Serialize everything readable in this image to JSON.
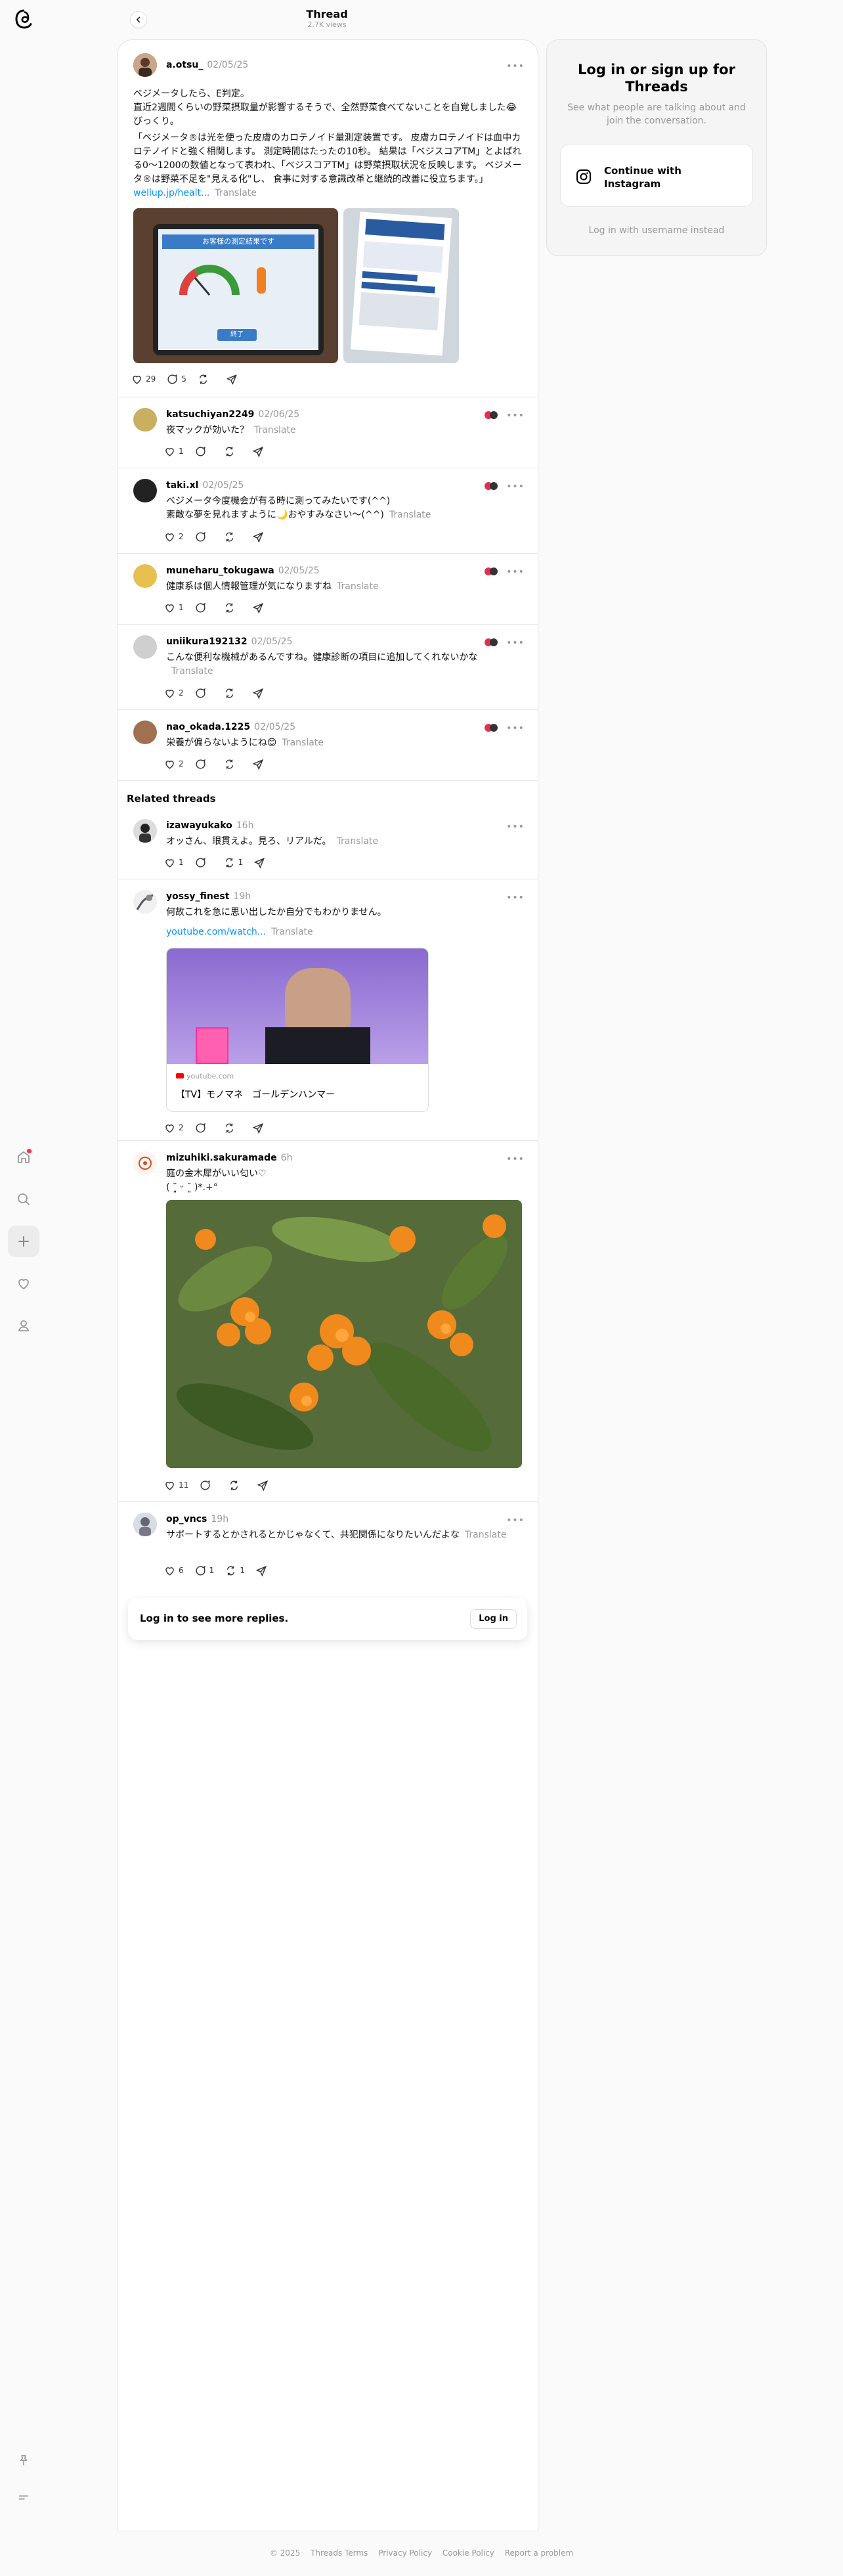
{
  "header": {
    "title": "Thread",
    "views": "2.7K views"
  },
  "main_post": {
    "username": "a.otsu_",
    "date": "02/05/25",
    "line1": "ベジメータしたら、E判定。",
    "line2": "直近2週間くらいの野菜摂取量が影響するそうで、全然野菜食べてないことを自覚しました😂びっくり。",
    "quote": "「ベジメータ®は光を使った皮膚のカロテノイド量測定装置です。 皮膚カロテノイドは血中カロテノイドと強く相関します。 測定時間はたったの10秒。 結果は「ベジスコアTM」とよばれる0〜1200の数値となって表われ、「ベジスコアTM」は野菜摂取状況を反映します。 ベジメータ®は野菜不足を\"見える化\"し、 食事に対する意識改革と継続的改善に役立ちます。」",
    "link": "wellup.jp/healt...",
    "translate": "Translate",
    "likes": "29",
    "comments": "5",
    "tablet_header": "お客様の測定結果です",
    "tablet_button": "終了"
  },
  "replies": [
    {
      "username": "katsuchiyan2249",
      "date": "02/06/25",
      "text": "夜マックが効いた？",
      "translate": "Translate",
      "likes": "1",
      "comments": ""
    },
    {
      "username": "taki.xl",
      "date": "02/05/25",
      "text": "ベジメータ今度機会が有る時に測ってみたいです(^^)",
      "text2": "素敵な夢を見れますように🌙おやすみなさい〜(^^)",
      "translate": "Translate",
      "likes": "2",
      "comments": ""
    },
    {
      "username": "muneharu_tokugawa",
      "date": "02/05/25",
      "text": "健康系は個人情報管理が気になりますね",
      "translate": "Translate",
      "likes": "1",
      "comments": ""
    },
    {
      "username": "uniikura192132",
      "date": "02/05/25",
      "text": "こんな便利な機械があるんですね。健康診断の項目に追加してくれないかな",
      "translate": "Translate",
      "likes": "2",
      "comments": ""
    },
    {
      "username": "nao_okada.1225",
      "date": "02/05/25",
      "text": "栄養が偏らないようにね😊",
      "translate": "Translate",
      "likes": "2",
      "comments": ""
    }
  ],
  "related_title": "Related threads",
  "related": [
    {
      "username": "izawayukako",
      "date": "16h",
      "text": "オッさん、眼貫えよ。見ろ、リアルだ。",
      "translate": "Translate",
      "likes": "1",
      "comments": "",
      "reposts": "1"
    },
    {
      "username": "yossy_finest",
      "date": "19h",
      "text": "何故これを急に思い出したか自分でもわかりません。",
      "link": "youtube.com/watch...",
      "translate": "Translate",
      "likes": "2",
      "comments": "",
      "card_domain": "youtube.com",
      "card_title": "【TV】モノマネ　ゴールデンハンマー"
    },
    {
      "username": "mizuhiki.sakuramade",
      "date": "6h",
      "text": "庭の金木犀がいい匂い♡",
      "text2": "( ˘͈ ᵕ ˘͈ )*.+°",
      "likes": "11",
      "comments": ""
    },
    {
      "username": "op_vncs",
      "date": "19h",
      "text": "サポートするとかされるとかじゃなくて、共犯関係になりたいんだよな",
      "translate": "Translate",
      "likes": "6",
      "comments": "1",
      "reposts": "1"
    }
  ],
  "login_banner": {
    "message": "Log in to see more replies.",
    "button": "Log in"
  },
  "right_card": {
    "title": "Log in or sign up for Threads",
    "subtitle": "See what people are talking about and join the conversation.",
    "continue_label": "Continue with Instagram",
    "alt_login": "Log in with username instead"
  },
  "footer": {
    "copyright": "© 2025",
    "links": [
      "Threads Terms",
      "Privacy Policy",
      "Cookie Policy",
      "Report a problem"
    ]
  },
  "colors": {
    "link": "#0095f6",
    "muted": "#999999",
    "notification_dot": "#ff3040"
  },
  "icons": [
    "threads-logo-icon",
    "home-icon",
    "search-icon",
    "plus-icon",
    "heart-icon",
    "profile-icon",
    "pin-icon",
    "menu-icon",
    "back-arrow-icon",
    "more-icon",
    "comment-icon",
    "repost-icon",
    "share-icon",
    "instagram-icon"
  ]
}
